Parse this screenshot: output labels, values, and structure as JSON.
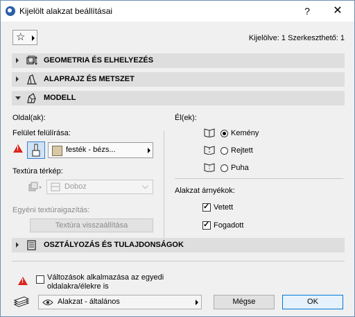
{
  "window": {
    "title": "Kijelölt alakzat beállításai",
    "help_label": "?",
    "close_label": "✕"
  },
  "header": {
    "selection_info": "Kijelölve: 1 Szerkeszthető: 1"
  },
  "sections": {
    "geometry": "GEOMETRIA ÉS ELHELYEZÉS",
    "floorplan": "ALAPRAJZ ÉS METSZET",
    "model": "MODELL",
    "classification": "OSZTÁLYOZÁS ÉS TULAJDONSÁGOK"
  },
  "model": {
    "sides_label": "Oldal(ak):",
    "surface_override_label": "Felület felülírása:",
    "surface_material": "festék - bézs...",
    "surface_swatch_color": "#d8c8a6",
    "texture_map_label": "Textúra térkép:",
    "texture_map_value": "Doboz",
    "custom_texture_label": "Egyéni textúraigazítás:",
    "reset_texture_button": "Textúra visszaállítása",
    "edges_label": "Él(ek):",
    "edge_options": [
      {
        "label": "Kemény",
        "selected": true
      },
      {
        "label": "Rejtett",
        "selected": false
      },
      {
        "label": "Puha",
        "selected": false
      }
    ],
    "shadows_label": "Alakzat árnyékok:",
    "shadow_options": [
      {
        "label": "Vetett",
        "checked": true
      },
      {
        "label": "Fogadott",
        "checked": true
      }
    ]
  },
  "footer": {
    "apply_label_line1": "Változások alkalmazása az egyedi",
    "apply_label_line2": "oldalakra/élekre is",
    "layer_value": "Alakzat - általános",
    "cancel_label": "Mégse",
    "ok_label": "OK"
  },
  "colors": {
    "accent": "#0078d7",
    "warning": "#d9241c",
    "section_bg": "#dedede"
  }
}
